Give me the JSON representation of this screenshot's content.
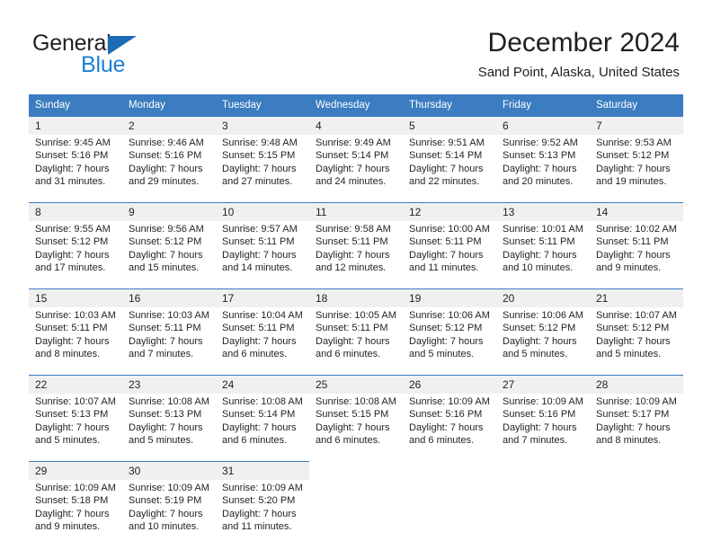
{
  "brand": {
    "name_part1": "General",
    "name_part2": "Blue",
    "accent_color": "#1c7fd4",
    "triangle_color": "#1c6cb5"
  },
  "header": {
    "title": "December 2024",
    "subtitle": "Sand Point, Alaska, United States"
  },
  "theme": {
    "header_bg": "#3b7dc0",
    "daynum_bg": "#f0f0f0",
    "text": "#231f20"
  },
  "weekday_headers": [
    "Sunday",
    "Monday",
    "Tuesday",
    "Wednesday",
    "Thursday",
    "Friday",
    "Saturday"
  ],
  "weeks": [
    [
      {
        "day": "1",
        "sunrise": "Sunrise: 9:45 AM",
        "sunset": "Sunset: 5:16 PM",
        "daylight1": "Daylight: 7 hours",
        "daylight2": "and 31 minutes."
      },
      {
        "day": "2",
        "sunrise": "Sunrise: 9:46 AM",
        "sunset": "Sunset: 5:16 PM",
        "daylight1": "Daylight: 7 hours",
        "daylight2": "and 29 minutes."
      },
      {
        "day": "3",
        "sunrise": "Sunrise: 9:48 AM",
        "sunset": "Sunset: 5:15 PM",
        "daylight1": "Daylight: 7 hours",
        "daylight2": "and 27 minutes."
      },
      {
        "day": "4",
        "sunrise": "Sunrise: 9:49 AM",
        "sunset": "Sunset: 5:14 PM",
        "daylight1": "Daylight: 7 hours",
        "daylight2": "and 24 minutes."
      },
      {
        "day": "5",
        "sunrise": "Sunrise: 9:51 AM",
        "sunset": "Sunset: 5:14 PM",
        "daylight1": "Daylight: 7 hours",
        "daylight2": "and 22 minutes."
      },
      {
        "day": "6",
        "sunrise": "Sunrise: 9:52 AM",
        "sunset": "Sunset: 5:13 PM",
        "daylight1": "Daylight: 7 hours",
        "daylight2": "and 20 minutes."
      },
      {
        "day": "7",
        "sunrise": "Sunrise: 9:53 AM",
        "sunset": "Sunset: 5:12 PM",
        "daylight1": "Daylight: 7 hours",
        "daylight2": "and 19 minutes."
      }
    ],
    [
      {
        "day": "8",
        "sunrise": "Sunrise: 9:55 AM",
        "sunset": "Sunset: 5:12 PM",
        "daylight1": "Daylight: 7 hours",
        "daylight2": "and 17 minutes."
      },
      {
        "day": "9",
        "sunrise": "Sunrise: 9:56 AM",
        "sunset": "Sunset: 5:12 PM",
        "daylight1": "Daylight: 7 hours",
        "daylight2": "and 15 minutes."
      },
      {
        "day": "10",
        "sunrise": "Sunrise: 9:57 AM",
        "sunset": "Sunset: 5:11 PM",
        "daylight1": "Daylight: 7 hours",
        "daylight2": "and 14 minutes."
      },
      {
        "day": "11",
        "sunrise": "Sunrise: 9:58 AM",
        "sunset": "Sunset: 5:11 PM",
        "daylight1": "Daylight: 7 hours",
        "daylight2": "and 12 minutes."
      },
      {
        "day": "12",
        "sunrise": "Sunrise: 10:00 AM",
        "sunset": "Sunset: 5:11 PM",
        "daylight1": "Daylight: 7 hours",
        "daylight2": "and 11 minutes."
      },
      {
        "day": "13",
        "sunrise": "Sunrise: 10:01 AM",
        "sunset": "Sunset: 5:11 PM",
        "daylight1": "Daylight: 7 hours",
        "daylight2": "and 10 minutes."
      },
      {
        "day": "14",
        "sunrise": "Sunrise: 10:02 AM",
        "sunset": "Sunset: 5:11 PM",
        "daylight1": "Daylight: 7 hours",
        "daylight2": "and 9 minutes."
      }
    ],
    [
      {
        "day": "15",
        "sunrise": "Sunrise: 10:03 AM",
        "sunset": "Sunset: 5:11 PM",
        "daylight1": "Daylight: 7 hours",
        "daylight2": "and 8 minutes."
      },
      {
        "day": "16",
        "sunrise": "Sunrise: 10:03 AM",
        "sunset": "Sunset: 5:11 PM",
        "daylight1": "Daylight: 7 hours",
        "daylight2": "and 7 minutes."
      },
      {
        "day": "17",
        "sunrise": "Sunrise: 10:04 AM",
        "sunset": "Sunset: 5:11 PM",
        "daylight1": "Daylight: 7 hours",
        "daylight2": "and 6 minutes."
      },
      {
        "day": "18",
        "sunrise": "Sunrise: 10:05 AM",
        "sunset": "Sunset: 5:11 PM",
        "daylight1": "Daylight: 7 hours",
        "daylight2": "and 6 minutes."
      },
      {
        "day": "19",
        "sunrise": "Sunrise: 10:06 AM",
        "sunset": "Sunset: 5:12 PM",
        "daylight1": "Daylight: 7 hours",
        "daylight2": "and 5 minutes."
      },
      {
        "day": "20",
        "sunrise": "Sunrise: 10:06 AM",
        "sunset": "Sunset: 5:12 PM",
        "daylight1": "Daylight: 7 hours",
        "daylight2": "and 5 minutes."
      },
      {
        "day": "21",
        "sunrise": "Sunrise: 10:07 AM",
        "sunset": "Sunset: 5:12 PM",
        "daylight1": "Daylight: 7 hours",
        "daylight2": "and 5 minutes."
      }
    ],
    [
      {
        "day": "22",
        "sunrise": "Sunrise: 10:07 AM",
        "sunset": "Sunset: 5:13 PM",
        "daylight1": "Daylight: 7 hours",
        "daylight2": "and 5 minutes."
      },
      {
        "day": "23",
        "sunrise": "Sunrise: 10:08 AM",
        "sunset": "Sunset: 5:13 PM",
        "daylight1": "Daylight: 7 hours",
        "daylight2": "and 5 minutes."
      },
      {
        "day": "24",
        "sunrise": "Sunrise: 10:08 AM",
        "sunset": "Sunset: 5:14 PM",
        "daylight1": "Daylight: 7 hours",
        "daylight2": "and 6 minutes."
      },
      {
        "day": "25",
        "sunrise": "Sunrise: 10:08 AM",
        "sunset": "Sunset: 5:15 PM",
        "daylight1": "Daylight: 7 hours",
        "daylight2": "and 6 minutes."
      },
      {
        "day": "26",
        "sunrise": "Sunrise: 10:09 AM",
        "sunset": "Sunset: 5:16 PM",
        "daylight1": "Daylight: 7 hours",
        "daylight2": "and 6 minutes."
      },
      {
        "day": "27",
        "sunrise": "Sunrise: 10:09 AM",
        "sunset": "Sunset: 5:16 PM",
        "daylight1": "Daylight: 7 hours",
        "daylight2": "and 7 minutes."
      },
      {
        "day": "28",
        "sunrise": "Sunrise: 10:09 AM",
        "sunset": "Sunset: 5:17 PM",
        "daylight1": "Daylight: 7 hours",
        "daylight2": "and 8 minutes."
      }
    ],
    [
      {
        "day": "29",
        "sunrise": "Sunrise: 10:09 AM",
        "sunset": "Sunset: 5:18 PM",
        "daylight1": "Daylight: 7 hours",
        "daylight2": "and 9 minutes."
      },
      {
        "day": "30",
        "sunrise": "Sunrise: 10:09 AM",
        "sunset": "Sunset: 5:19 PM",
        "daylight1": "Daylight: 7 hours",
        "daylight2": "and 10 minutes."
      },
      {
        "day": "31",
        "sunrise": "Sunrise: 10:09 AM",
        "sunset": "Sunset: 5:20 PM",
        "daylight1": "Daylight: 7 hours",
        "daylight2": "and 11 minutes."
      },
      {
        "day": "",
        "sunrise": "",
        "sunset": "",
        "daylight1": "",
        "daylight2": ""
      },
      {
        "day": "",
        "sunrise": "",
        "sunset": "",
        "daylight1": "",
        "daylight2": ""
      },
      {
        "day": "",
        "sunrise": "",
        "sunset": "",
        "daylight1": "",
        "daylight2": ""
      },
      {
        "day": "",
        "sunrise": "",
        "sunset": "",
        "daylight1": "",
        "daylight2": ""
      }
    ]
  ]
}
